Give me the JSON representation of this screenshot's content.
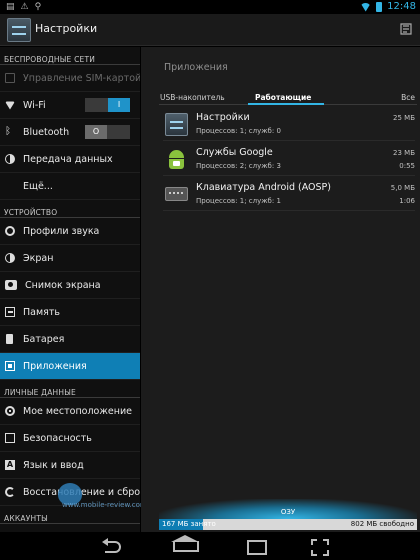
{
  "action_bar": {
    "title": "Настройки"
  },
  "status_bar": {
    "time": "12:48"
  },
  "left_panel": {
    "sections": [
      {
        "header": "БЕСПРОВОДНЫЕ СЕТИ",
        "items": [
          {
            "label": "Управление SIM-картой",
            "icon": "sim-icon",
            "disabled": true
          },
          {
            "label": "Wi-Fi",
            "icon": "wifi-icon",
            "toggle": "on",
            "toggle_text": "I"
          },
          {
            "label": "Bluetooth",
            "icon": "bluetooth-icon",
            "toggle": "off",
            "toggle_text": "O"
          },
          {
            "label": "Передача данных",
            "icon": "data-usage-icon"
          },
          {
            "label": "Ещё..."
          }
        ]
      },
      {
        "header": "УСТРОЙСТВО",
        "items": [
          {
            "label": "Профили звука",
            "icon": "sound-icon"
          },
          {
            "label": "Экран",
            "icon": "display-icon"
          },
          {
            "label": "Снимок экрана",
            "icon": "camera-icon"
          },
          {
            "label": "Память",
            "icon": "storage-icon"
          },
          {
            "label": "Батарея",
            "icon": "battery-icon"
          },
          {
            "label": "Приложения",
            "icon": "apps-icon",
            "active": true
          }
        ]
      },
      {
        "header": "ЛИЧНЫЕ ДАННЫЕ",
        "items": [
          {
            "label": "Мое местоположение",
            "icon": "location-icon"
          },
          {
            "label": "Безопасность",
            "icon": "lock-icon"
          },
          {
            "label": "Язык и ввод",
            "icon": "language-icon"
          },
          {
            "label": "Восстановление и сброс",
            "icon": "reset-icon"
          }
        ]
      },
      {
        "header": "АККАУНТЫ",
        "items": []
      }
    ]
  },
  "right_panel": {
    "title": "Приложения",
    "tabs": [
      "USB-накопитель",
      "Работающие",
      "Все"
    ],
    "active_tab": 1,
    "apps": [
      {
        "name": "Настройки",
        "info": "Процессов: 1; служб: 0",
        "size": "25 МБ",
        "time": ""
      },
      {
        "name": "Службы Google",
        "info": "Процессов: 2; служб: 3",
        "size": "23 МБ",
        "time": "0:55"
      },
      {
        "name": "Клавиатура Android (AOSP)",
        "info": "Процессов: 1; служб: 1",
        "size": "5,0 МБ",
        "time": "1:06"
      }
    ],
    "ram": {
      "label": "ОЗУ",
      "used_text": "167 МБ занято",
      "free_text": "802 МБ свободно",
      "used_fraction": 0.17
    }
  },
  "watermark": {
    "text": "www.mobile-review.com"
  }
}
